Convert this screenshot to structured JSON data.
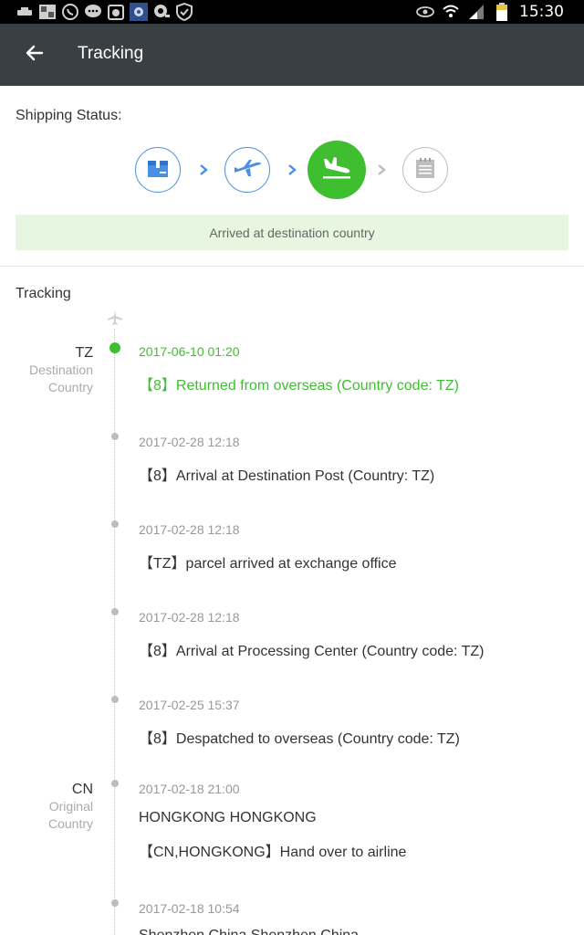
{
  "statusbar": {
    "time": "15:30",
    "icons": [
      "usb-icon",
      "image-icon",
      "whatsapp-icon",
      "chat-icon",
      "screenshot-icon",
      "flower-app-icon",
      "search-app-icon",
      "shield-check-icon",
      "eye-icon",
      "wifi-icon",
      "signal-icon",
      "battery-icon"
    ]
  },
  "appbar": {
    "title": "Tracking",
    "back_icon": "arrow-left-icon"
  },
  "shipping": {
    "label": "Shipping Status:",
    "steps": [
      {
        "icon": "package-icon",
        "state": "done"
      },
      {
        "icon": "plane-takeoff-icon",
        "state": "done"
      },
      {
        "icon": "plane-landing-icon",
        "state": "active"
      },
      {
        "icon": "document-icon",
        "state": "pending"
      }
    ],
    "status_text": "Arrived at destination country",
    "colors": {
      "accent": "#3fbe2f",
      "outline": "#4a90e2",
      "banner": "#e6f6e0"
    }
  },
  "tracking": {
    "title": "Tracking",
    "groups": [
      {
        "code": "TZ",
        "label_line1": "Destination",
        "label_line2": "Country"
      },
      {
        "code": "CN",
        "label_line1": "Original",
        "label_line2": "Country"
      }
    ],
    "events": [
      {
        "time": "2017-06-10 01:20",
        "desc": "【8】Returned from overseas (Country code: TZ)",
        "highlight": true
      },
      {
        "time": "2017-02-28 12:18",
        "desc": "【8】Arrival at Destination Post (Country: TZ)"
      },
      {
        "time": "2017-02-28 12:18",
        "desc": "【TZ】parcel arrived at exchange office"
      },
      {
        "time": "2017-02-28 12:18",
        "desc": "【8】Arrival at Processing Center (Country code: TZ)"
      },
      {
        "time": "2017-02-25 15:37",
        "desc": "【8】Despatched to overseas (Country code: TZ)"
      },
      {
        "time": "2017-02-18 21:00",
        "desc": "HONGKONG HONGKONG",
        "desc2": "【CN,HONGKONG】Hand over to airline"
      },
      {
        "time": "2017-02-18 10:54",
        "desc": "Shenzhen China Shenzhen China"
      }
    ]
  }
}
